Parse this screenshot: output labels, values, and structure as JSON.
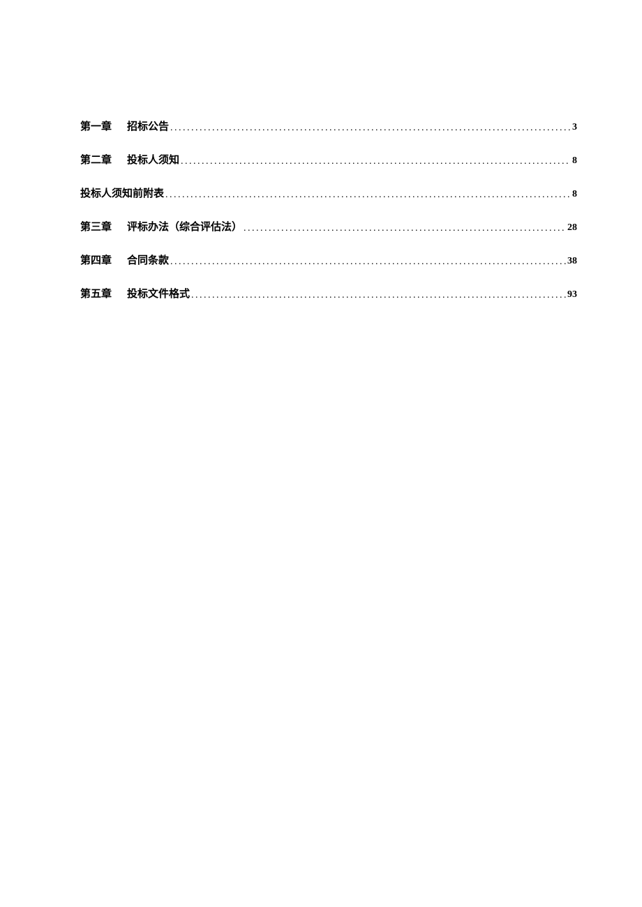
{
  "toc": [
    {
      "chapter": "第一章",
      "title": "招标公告",
      "page": "3"
    },
    {
      "chapter": "第二章",
      "title": "投标人须知",
      "page": "8"
    },
    {
      "chapter": "",
      "title": "投标人须知前附表",
      "page": "8"
    },
    {
      "chapter": "第三章",
      "title": "评标办法（综合评估法）",
      "page": "28"
    },
    {
      "chapter": "第四章",
      "title": "合同条款",
      "page": "38"
    },
    {
      "chapter": "第五章",
      "title": "投标文件格式",
      "page": "93"
    }
  ]
}
